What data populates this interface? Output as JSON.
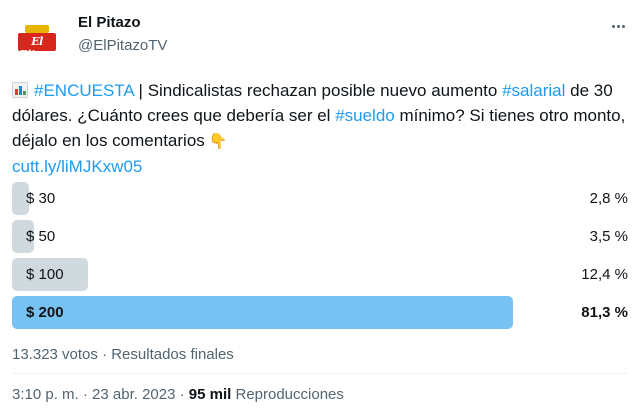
{
  "author": {
    "display_name": "El Pitazo",
    "handle": "@ElPitazoTV",
    "avatar_logo_text": "El Pitazo"
  },
  "tweet": {
    "hashtag1": "#ENCUESTA",
    "text1": " | Sindicalistas rechazan posible nuevo aumento ",
    "hashtag2": "#salarial",
    "text2": " de 30 dólares. ¿Cuánto crees que debería ser el ",
    "hashtag3": "#sueldo",
    "text3": " mínimo? Si tienes otro monto, déjalo en los comentarios",
    "link": "cutt.ly/liMJKxw05"
  },
  "poll": {
    "options": [
      {
        "label": "$ 30",
        "percent_text": "2,8 %",
        "fraction": 0.028
      },
      {
        "label": "$ 50",
        "percent_text": "3,5 %",
        "fraction": 0.035
      },
      {
        "label": "$ 100",
        "percent_text": "12,4 %",
        "fraction": 0.124
      },
      {
        "label": "$ 200",
        "percent_text": "81,3 %",
        "fraction": 0.813
      }
    ],
    "meta": "13.323 votos · Resultados finales"
  },
  "footer": {
    "time": "3:10 p. m. · 23 abr. 2023 · ",
    "views_count": "95 mil",
    "views_label": " Reproducciones"
  },
  "colors": {
    "link": "#1d9bf0",
    "bar": "#cfd9de",
    "winner_bar": "#78c1f3",
    "secondary_text": "#536471"
  },
  "icons": [
    "more-options-icon",
    "bar-chart-emoji-icon",
    "pointing-down-emoji-icon"
  ]
}
